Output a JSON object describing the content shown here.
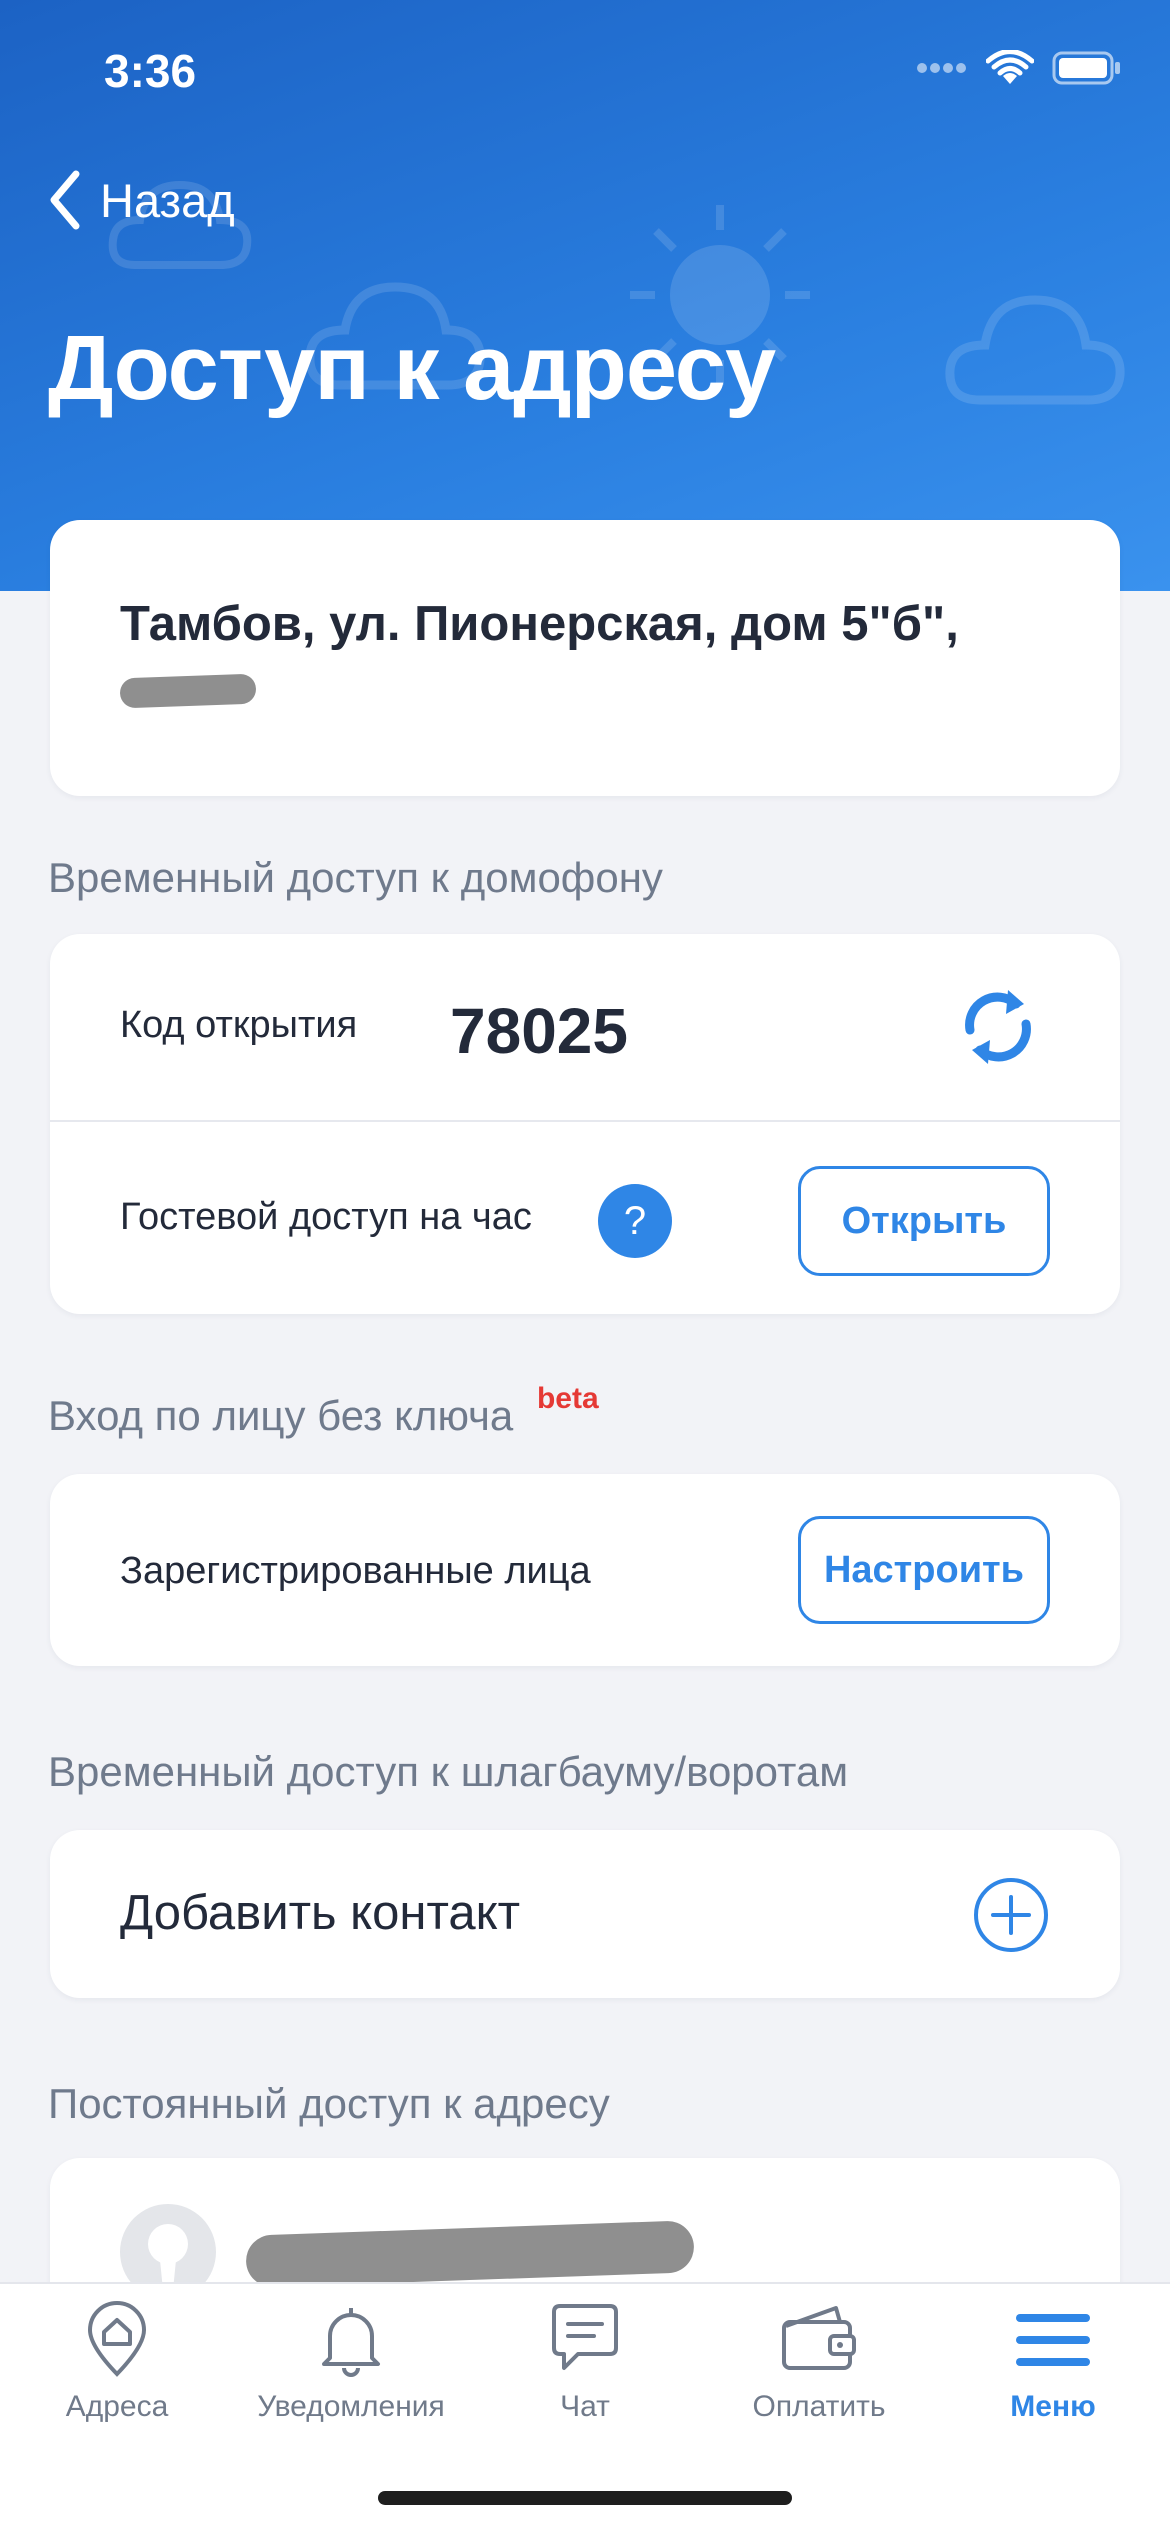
{
  "status_bar": {
    "time": "3:36"
  },
  "nav": {
    "back_label": "Назад",
    "title": "Доступ к адресу"
  },
  "address": {
    "line1": "Тамбов, ул. Пионерская, дом 5\"б\","
  },
  "intercom": {
    "section_label": "Временный доступ к домофону",
    "code_label": "Код открытия",
    "code_value": "78025",
    "guest_label": "Гостевой доступ на час",
    "help_glyph": "?",
    "open_button": "Открыть"
  },
  "face": {
    "section_label": "Вход по лицу без ключа",
    "beta_badge": "beta",
    "registered_label": "Зарегистрированные лица",
    "configure_button": "Настроить"
  },
  "barrier": {
    "section_label": "Временный доступ к шлагбауму/воротам",
    "add_contact_label": "Добавить контакт"
  },
  "permanent": {
    "section_label": "Постоянный доступ к адресу"
  },
  "tabbar": {
    "items": [
      {
        "label": "Адреса",
        "icon": "home-pin-icon",
        "active": false
      },
      {
        "label": "Уведомления",
        "icon": "bell-icon",
        "active": false
      },
      {
        "label": "Чат",
        "icon": "chat-icon",
        "active": false
      },
      {
        "label": "Оплатить",
        "icon": "wallet-icon",
        "active": false
      },
      {
        "label": "Меню",
        "icon": "menu-icon",
        "active": true
      }
    ]
  },
  "colors": {
    "accent": "#2f86e6",
    "header_blue": "#1c62c4",
    "beta_red": "#e53935",
    "background": "#f2f3f7"
  }
}
